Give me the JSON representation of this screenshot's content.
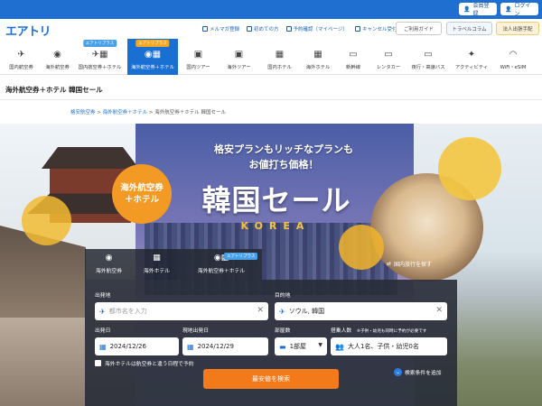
{
  "topbar": {
    "member_label": "会員登録",
    "login_label": "ログイン"
  },
  "header": {
    "logo": "エアトリ",
    "links": [
      "メルマガ登録",
      "初めての方",
      "予約確認（マイページ）",
      "キャンセル受付"
    ],
    "guide_button": "ご利用ガイド",
    "column_button": "トラベルコラム",
    "corporate_button": "法人出張手配"
  },
  "nav": {
    "items": [
      {
        "label": "国内航空券",
        "icon": "airplane-icon",
        "glyph": "✈",
        "tag": ""
      },
      {
        "label": "海外航空券",
        "icon": "globe-icon",
        "glyph": "🌐",
        "tag": ""
      },
      {
        "label": "国内航空券＋ホテル",
        "icon": "plane-hotel-icon",
        "glyph": "✈▦",
        "tag": "エアトリプラス"
      },
      {
        "label": "海外航空券＋ホテル",
        "icon": "globe-hotel-icon",
        "glyph": "🌐▦",
        "tag": "エアトリプラス"
      },
      {
        "label": "国内ツアー",
        "icon": "suitcase-icon",
        "glyph": "💼",
        "tag": ""
      },
      {
        "label": "海外ツアー",
        "icon": "suitcase-globe-icon",
        "glyph": "💼",
        "tag": ""
      },
      {
        "label": "国内ホテル",
        "icon": "hotel-icon",
        "glyph": "▦",
        "tag": ""
      },
      {
        "label": "海外ホテル",
        "icon": "hotel-globe-icon",
        "glyph": "▦",
        "tag": ""
      },
      {
        "label": "新幹線",
        "icon": "train-icon",
        "glyph": "🚄",
        "tag": ""
      },
      {
        "label": "レンタカー",
        "icon": "car-icon",
        "glyph": "🚗",
        "tag": ""
      },
      {
        "label": "夜行・高速バス",
        "icon": "bus-icon",
        "glyph": "🚌",
        "tag": ""
      },
      {
        "label": "アクティビティ",
        "icon": "activity-icon",
        "glyph": "✦",
        "tag": ""
      },
      {
        "label": "WiFi・eSIM",
        "icon": "wifi-icon",
        "glyph": "📶",
        "tag": ""
      }
    ],
    "active_index": 3
  },
  "page": {
    "title": "海外航空券＋ホテル 韓国セール",
    "breadcrumb": [
      "格安航空券",
      "海外航空券＋ホテル",
      "海外航空券＋ホテル 韓国セール"
    ]
  },
  "hero": {
    "subtitle_line1": "格安プランもリッチなプランも",
    "subtitle_line2": "お値打ち価格！",
    "badge_line1": "海外航空券",
    "badge_line2": "＋ホテル",
    "title": "韓国セール",
    "korea": "KOREA"
  },
  "search": {
    "tabs": [
      {
        "label": "海外航空券",
        "icon": "globe-icon"
      },
      {
        "label": "海外ホテル",
        "icon": "hotel-icon"
      },
      {
        "label": "海外航空券＋ホテル",
        "icon": "globe-hotel-icon",
        "tag": "エアトリプラス"
      }
    ],
    "domestic_link": "国内旅行を探す",
    "origin_label": "出発地",
    "origin_placeholder": "都市名を入力",
    "destination_label": "目的地",
    "destination_value": "ソウル, 韓国",
    "depart_label": "出発日",
    "depart_value": "2024/12/26",
    "return_label": "現地出発日",
    "return_value": "2024/12/29",
    "rooms_label": "部屋数",
    "rooms_value": "1部屋",
    "guests_label": "搭乗人数",
    "guests_note": "※子供・幼児も同時に予約が必要です",
    "guests_value": "大人1名、子供・幼児0名",
    "checkbox_label": "海外ホテルは航空券と違う日程で予約",
    "add_conditions": "検索条件を追加",
    "search_button": "最安値を検索"
  }
}
